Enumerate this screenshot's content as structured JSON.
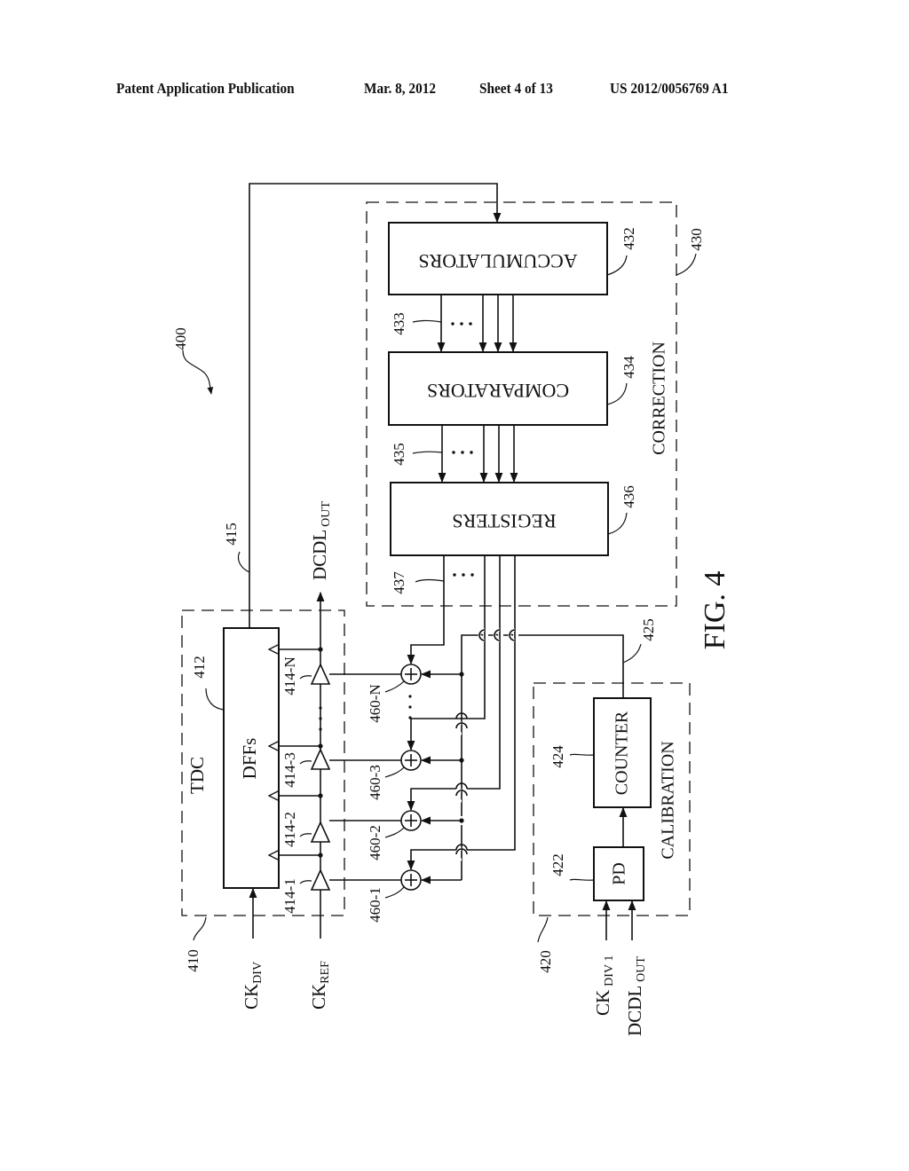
{
  "header": {
    "publication": "Patent Application Publication",
    "date": "Mar. 8, 2012",
    "sheet": "Sheet 4 of 13",
    "number": "US 2012/0056769 A1"
  },
  "figure": {
    "caption": "FIG. 4",
    "ref_system": "400",
    "blocks": {
      "tdc": {
        "ref": "410",
        "title": "TDC"
      },
      "dffs": {
        "ref": "412",
        "label": "DFFs"
      },
      "calibration": {
        "ref": "420",
        "title": "CALIBRATION"
      },
      "pd": {
        "ref": "422",
        "label": "PD"
      },
      "counter": {
        "ref": "424",
        "label": "COUNTER"
      },
      "correction": {
        "ref": "430",
        "title": "CORRECTION"
      },
      "accumulators": {
        "ref": "432",
        "label": "ACCUMULATORS"
      },
      "comparators": {
        "ref": "434",
        "label": "COMPARATORS"
      },
      "registers": {
        "ref": "436",
        "label": "REGISTERS"
      }
    },
    "signals": {
      "ck_div": {
        "main": "CK",
        "sub": "DIV"
      },
      "ck_ref": {
        "main": "CK",
        "sub": "REF"
      },
      "ck_div1": {
        "main": "CK",
        "sub": "DIV 1"
      },
      "dcdl_out_in": {
        "main": "DCDL",
        "sub": "OUT"
      },
      "dcdl_out_top": {
        "main": "DCDL",
        "sub": "OUT"
      }
    },
    "buses": {
      "b415": "415",
      "b425": "425",
      "b433": "433",
      "b435": "435",
      "b437": "437"
    },
    "delay_cells": [
      "414-1",
      "414-2",
      "414-3",
      "414-N"
    ],
    "adders": [
      "460-1",
      "460-2",
      "460-3",
      "460-N"
    ],
    "ellipsis": "· · ·"
  }
}
